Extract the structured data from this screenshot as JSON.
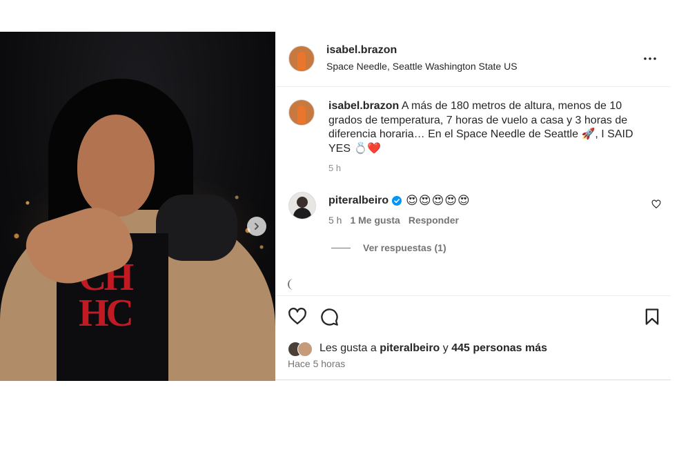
{
  "post": {
    "photo": {
      "shirt_text": "CH\nHC",
      "next_icon": "chevron-right-icon"
    },
    "header": {
      "username": "isabel.brazon",
      "location": "Space Needle, Seattle Washington State US",
      "more_icon": "more-horizontal-icon"
    },
    "caption": {
      "username": "isabel.brazon",
      "text": "A más de 180 metros de altura, menos de 10 grados de temperatura, 7 horas de vuelo a casa y 3 horas de diferencia horaria… En el Space Needle de Seattle 🚀, I SAID YES 💍❤️",
      "time": "5 h"
    },
    "comment": {
      "username": "piteralbeiro",
      "verified": true,
      "text": "😍😍😍😍😍",
      "time": "5 h",
      "likes": "1 Me gusta",
      "reply_label": "Responder",
      "view_replies": "Ver respuestas (1)"
    },
    "actions": {
      "icons": [
        "heart-icon",
        "comment-icon",
        "bookmark-icon"
      ],
      "likes_prefix": "Les gusta a",
      "likes_user": "piteralbeiro",
      "likes_connector": "y",
      "likes_others": "445 personas más",
      "time_ago": "Hace 5 horas"
    },
    "colors": {
      "text": "#262626",
      "muted": "#737373",
      "verified": "#0095f6",
      "border": "#efefef"
    }
  }
}
